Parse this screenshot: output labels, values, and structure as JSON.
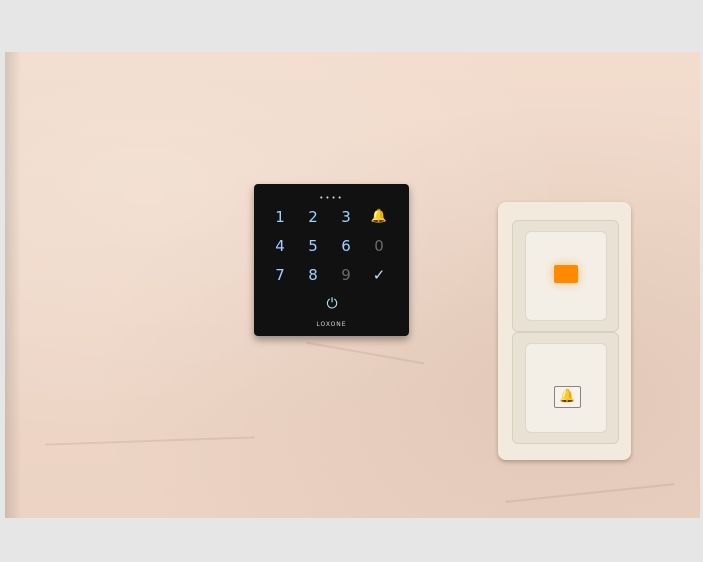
{
  "keypad": {
    "status_dots": "••••",
    "keys": [
      {
        "label": "1",
        "icon": "key-1"
      },
      {
        "label": "2",
        "icon": "key-2"
      },
      {
        "label": "3",
        "icon": "key-3"
      },
      {
        "label": "🔔",
        "icon": "bell-icon"
      },
      {
        "label": "4",
        "icon": "key-4"
      },
      {
        "label": "5",
        "icon": "key-5"
      },
      {
        "label": "6",
        "icon": "key-6"
      },
      {
        "label": "0",
        "icon": "key-0"
      },
      {
        "label": "7",
        "icon": "key-7"
      },
      {
        "label": "8",
        "icon": "key-8"
      },
      {
        "label": "9",
        "icon": "key-9"
      },
      {
        "label": "✓",
        "icon": "check-icon"
      },
      {
        "label": "⏻",
        "icon": "power-icon"
      }
    ],
    "brand": "LOXONE"
  },
  "wall_switch": {
    "top_indicator_color": "#ff8a00",
    "bottom_icon": "bell-icon",
    "bottom_icon_glyph": "🔔"
  },
  "colors": {
    "wall": "#efd8c8",
    "keypad_bg": "#111111",
    "keypad_digit": "#9fd1ff",
    "keypad_bell": "#5cff85",
    "switch_plate": "#f2eadc"
  }
}
